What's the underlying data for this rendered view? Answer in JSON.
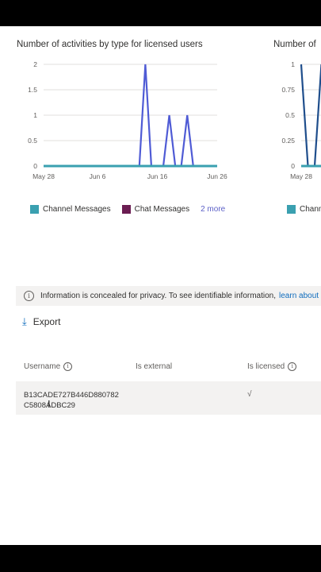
{
  "charts": {
    "left_title": "Number of activities by type for licensed users",
    "right_title": "Number of"
  },
  "chart_data": [
    {
      "type": "line",
      "title": "Number of activities by type for licensed users",
      "x_tick_labels": [
        "May 28",
        "Jun 6",
        "Jun 16",
        "Jun 26"
      ],
      "y_tick_labels": [
        "0",
        "0.5",
        "1",
        "1.5",
        "2"
      ],
      "ylim": [
        0,
        2
      ],
      "x_start": "May 28",
      "x_end": "Jun 26",
      "grid": true,
      "series": [
        {
          "name": "Channel Messages",
          "color": "#3aa0b0",
          "x": [
            "May 28",
            "Jun 26"
          ],
          "values": [
            0,
            0
          ]
        },
        {
          "name": "Chat Messages",
          "color": "#6b1d52",
          "x": [
            "May 28",
            "Jun 26"
          ],
          "values": [
            0,
            0
          ]
        },
        {
          "color": "#4f5bd5",
          "x": [
            "May 28",
            "Jun 13",
            "Jun 14",
            "Jun 15",
            "Jun 17",
            "Jun 18",
            "Jun 19",
            "Jun 20",
            "Jun 21",
            "Jun 22",
            "Jun 23",
            "Jun 26"
          ],
          "values": [
            0,
            0,
            2,
            0,
            0,
            1,
            0,
            0,
            1,
            0,
            0,
            0
          ]
        }
      ],
      "legend": [
        "Channel Messages",
        "Chat Messages"
      ],
      "legend_more": "2 more",
      "legend_position": "bottom"
    },
    {
      "type": "line",
      "title": "Number of",
      "x_tick_labels": [
        "May 28"
      ],
      "y_tick_labels": [
        "0",
        "0.25",
        "0.5",
        "0.75",
        "1"
      ],
      "ylim": [
        0,
        1
      ],
      "grid": true,
      "series": [
        {
          "color": "#1f4e8c",
          "x": [
            "May 28",
            "May 29",
            "May 30",
            "May 31"
          ],
          "values": [
            1,
            0,
            0,
            1
          ]
        }
      ],
      "legend": [
        "Chann"
      ],
      "legend_position": "bottom"
    }
  ],
  "info": {
    "text": "Information is concealed for privacy. To see identifiable information,",
    "link": "learn about r"
  },
  "toolbar": {
    "export_label": "Export"
  },
  "table": {
    "headers": [
      "Username",
      "Is external",
      "Is licensed"
    ],
    "rows": [
      {
        "username_line1": "B13CADE727B446D880782",
        "username_line2": "C5808ADBC29",
        "is_external": "",
        "is_licensed": "√"
      }
    ]
  },
  "colors": {
    "channel": "#3aa0b0",
    "chat": "#6b1d52",
    "other": "#4f5bd5",
    "link": "#0f6cbd"
  }
}
